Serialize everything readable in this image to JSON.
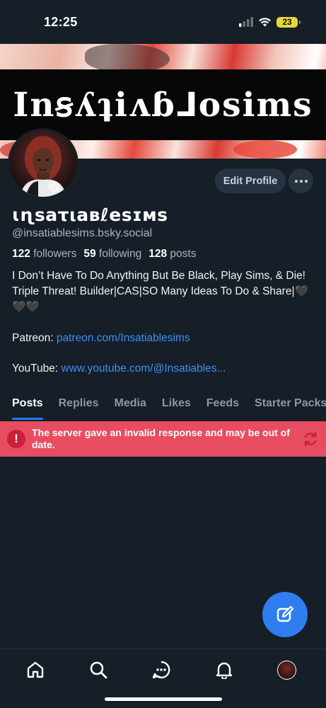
{
  "status_bar": {
    "time": "12:25",
    "battery": "23"
  },
  "banner": {
    "text": "Inꞩʎʇiʌɓ⅃ᴏsims"
  },
  "profile": {
    "edit_label": "Edit Profile",
    "display_name": "ɩɳsaτιaʙℓesɪᴍs",
    "handle": "@insatiablesims.bsky.social",
    "stats": {
      "followers_count": "122",
      "followers_label": "followers",
      "following_count": "59",
      "following_label": "following",
      "posts_count": "128",
      "posts_label": "posts"
    },
    "bio": "I Don’t Have To Do Anything But Be Black, Play Sims, & Die! Triple Threat! Builder|CAS|SO Many Ideas To Do & Share|🖤🖤🖤",
    "patreon_label": "Patreon:",
    "patreon_link": "patreon.com/Insatiablesims",
    "youtube_label": "YouTube:",
    "youtube_link": "www.youtube.com/@Insatiables..."
  },
  "tabs": [
    {
      "label": "Posts",
      "active": true
    },
    {
      "label": "Replies"
    },
    {
      "label": "Media"
    },
    {
      "label": "Likes"
    },
    {
      "label": "Feeds"
    },
    {
      "label": "Starter Packs"
    }
  ],
  "error": {
    "icon": "!",
    "message": "The server gave an invalid response and may be out of date."
  },
  "colors": {
    "background": "#161e27",
    "accent": "#1d7df0",
    "error": "#e84c61",
    "link": "#3f8ff0"
  },
  "icons": [
    "signal-icon",
    "wifi-icon",
    "battery-icon",
    "more-icon",
    "alert-icon",
    "refresh-icon",
    "compose-icon",
    "home-icon",
    "search-icon",
    "chat-icon",
    "bell-icon",
    "profile-avatar"
  ]
}
